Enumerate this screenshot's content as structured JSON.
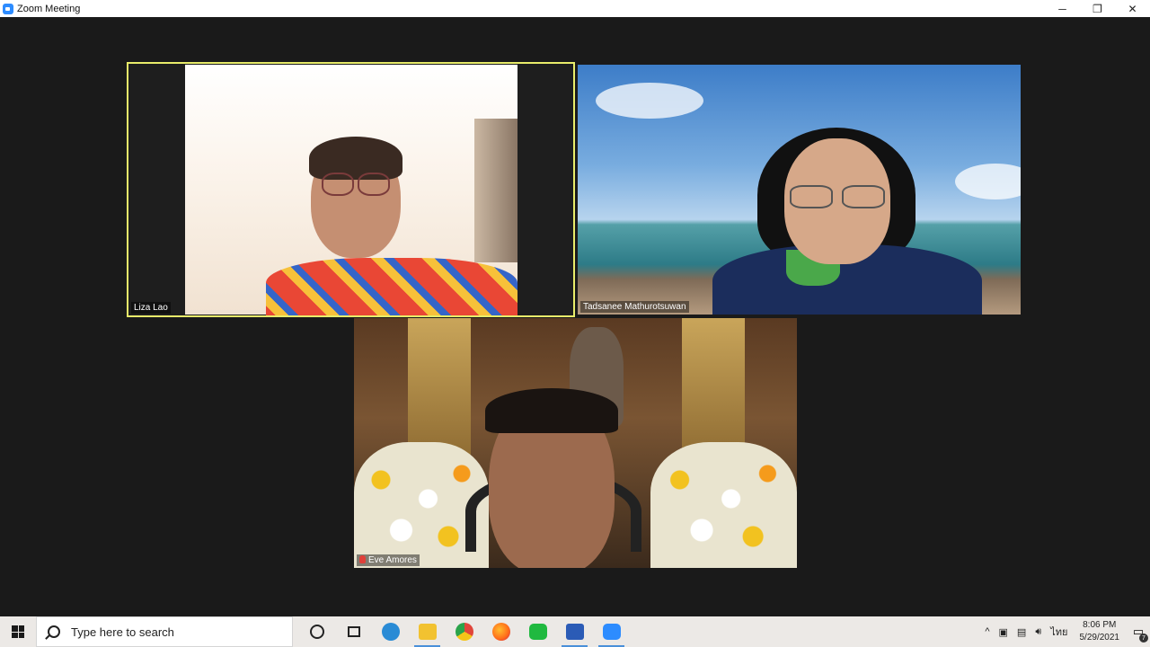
{
  "window": {
    "title": "Zoom Meeting",
    "controls": {
      "minimize": "─",
      "restore": "❐",
      "close": "✕"
    }
  },
  "participants": [
    {
      "name": "Liza Lao",
      "speaking": true,
      "muted": false
    },
    {
      "name": "Tadsanee Mathurotsuwan",
      "speaking": false,
      "muted": false
    },
    {
      "name": "Eve Amores",
      "speaking": false,
      "muted": true
    }
  ],
  "colors": {
    "active_speaker_border": "#e8ec6a",
    "meeting_bg": "#1a1a1a",
    "zoom_blue": "#2d8cff",
    "muted_red": "#e0403a"
  },
  "taskbar": {
    "search_placeholder": "Type here to search",
    "apps": [
      {
        "name": "edge-icon",
        "color": "#2a8bd5"
      },
      {
        "name": "file-explorer-icon",
        "color": "#f2c230"
      },
      {
        "name": "chrome-icon",
        "color": "#e0453a"
      },
      {
        "name": "firefox-icon",
        "color": "#ff7a1a"
      },
      {
        "name": "line-icon",
        "color": "#20b940"
      },
      {
        "name": "word-icon",
        "color": "#2b5bb6"
      },
      {
        "name": "zoom-icon",
        "color": "#2d8cff"
      }
    ],
    "tray": {
      "chevron": "^",
      "language": "ไทย",
      "time": "8:06 PM",
      "date": "5/29/2021",
      "notification_count": "7"
    }
  }
}
